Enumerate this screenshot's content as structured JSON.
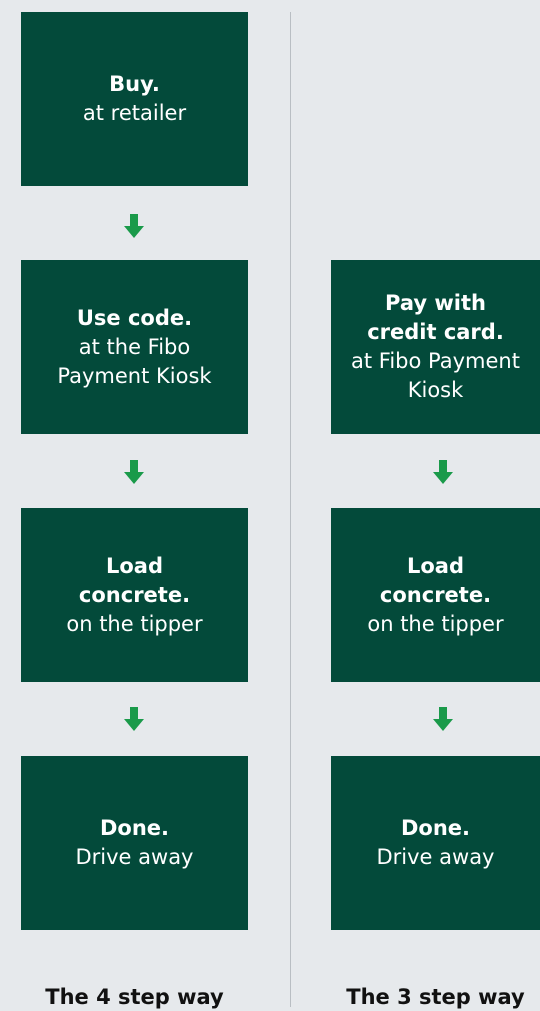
{
  "colors": {
    "background": "#e6e9ec",
    "box": "#034a3a",
    "arrow": "#1a9a4a",
    "divider": "#b9bec3"
  },
  "left_flow": {
    "steps": [
      {
        "title": "Buy.",
        "subtitle": "at retailer"
      },
      {
        "title": "Use code.",
        "subtitle": "at the Fibo Payment Kiosk"
      },
      {
        "title": "Load concrete.",
        "subtitle": "on the tipper"
      },
      {
        "title": "Done.",
        "subtitle": "Drive away"
      }
    ],
    "caption": "The 4 step way"
  },
  "right_flow": {
    "steps": [
      {
        "title": "Pay with credit card.",
        "subtitle": "at Fibo Payment Kiosk"
      },
      {
        "title": "Load concrete.",
        "subtitle": "on the tipper"
      },
      {
        "title": "Done.",
        "subtitle": "Drive away"
      }
    ],
    "caption": "The 3 step way"
  },
  "icons": {
    "arrow": "arrow-down-icon"
  }
}
